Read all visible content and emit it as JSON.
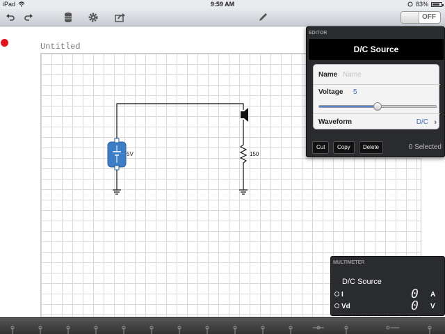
{
  "status_bar": {
    "device": "iPad",
    "time": "9:59 AM",
    "battery": "83%",
    "battery_level": 0.83
  },
  "toolbar": {
    "undo_icon": "undo-icon",
    "redo_icon": "redo-icon",
    "library_icon": "database-icon",
    "settings_icon": "gear-icon",
    "share_icon": "share-icon",
    "edit_icon": "pencil-icon",
    "simulation_toggle": "OFF"
  },
  "document": {
    "title": "Untitled"
  },
  "circuit": {
    "battery_label": "5V",
    "resistor_label": "150"
  },
  "editor": {
    "header": "EDITOR",
    "title": "D/C Source",
    "name_label": "Name",
    "name_placeholder": "Name",
    "voltage_label": "Voltage",
    "voltage_value": "5",
    "voltage_slider_level": 0.5,
    "waveform_label": "Waveform",
    "waveform_value": "D/C",
    "cut_label": "Cut",
    "copy_label": "Copy",
    "delete_label": "Delete",
    "selected_text": "0 Selected"
  },
  "multimeter": {
    "header": "MULTIMETER",
    "source": "D/C Source",
    "current_label": "I",
    "current_value": "0",
    "current_unit": "A",
    "voltage_label": "Vd",
    "voltage_value": "0",
    "voltage_unit": "V"
  },
  "colors": {
    "accent": "#3d6ec2",
    "record": "#e0141a",
    "component": "#3d7dc6"
  }
}
